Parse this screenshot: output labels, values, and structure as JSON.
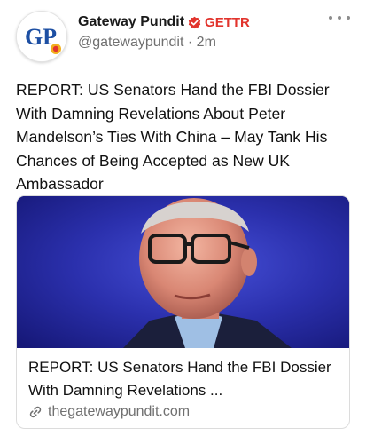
{
  "post": {
    "author_name": "Gateway Pundit",
    "platform_label": "GETTR",
    "handle": "@gatewaypundit",
    "separator": "·",
    "timestamp": "2m",
    "text": "REPORT: US Senators Hand the FBI Dossier With Damning Revelations About Peter Mandelson’s Ties With China – May Tank His Chances of Being Accepted as New UK Ambassador"
  },
  "avatar": {
    "logo_text": "GP"
  },
  "icons": {
    "verified": "verified-badge-icon",
    "more": "more-options-icon",
    "link": "link-icon"
  },
  "link_card": {
    "title": "REPORT: US Senators Hand the FBI Dossier With Damning Revelations ...",
    "domain": "thegatewaypundit.com"
  },
  "colors": {
    "gettr_red": "#e2342d",
    "logo_blue": "#1d4fa3",
    "image_background": "#2a2ea6"
  }
}
